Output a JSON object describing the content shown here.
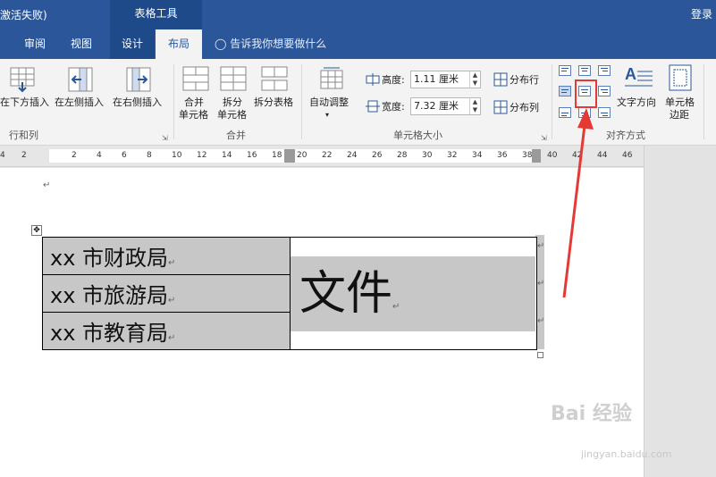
{
  "titlebar": {
    "title": "激活失败)",
    "contextual_tool": "表格工具",
    "login": "登录"
  },
  "tabs": [
    {
      "label": "审阅"
    },
    {
      "label": "视图"
    },
    {
      "label": "设计"
    },
    {
      "label": "布局"
    }
  ],
  "tell_me": "告诉我你想要做什么",
  "ribbon": {
    "rows_cols": {
      "insert_below": "在下方插入",
      "insert_left": "在左侧插入",
      "insert_right": "在右侧插入",
      "group_label": "行和列"
    },
    "merge": {
      "merge_cells_1": "合并",
      "merge_cells_2": "单元格",
      "split_cells_1": "拆分",
      "split_cells_2": "单元格",
      "split_table": "拆分表格",
      "group_label": "合并"
    },
    "cell_size": {
      "autofit": "自动调整",
      "height_label": "高度:",
      "height_value": "1.11 厘米",
      "width_label": "宽度:",
      "width_value": "7.32 厘米",
      "distribute_rows": "分布行",
      "distribute_cols": "分布列",
      "group_label": "单元格大小"
    },
    "alignment": {
      "text_direction": "文字方向",
      "cell_margins_1": "单元格",
      "cell_margins_2": "边距",
      "group_label": "对齐方式"
    }
  },
  "ruler": {
    "ticks": [
      "4",
      "2",
      "2",
      "4",
      "6",
      "8",
      "10",
      "12",
      "14",
      "16",
      "18",
      "20",
      "22",
      "24",
      "26",
      "28",
      "30",
      "32",
      "34",
      "36",
      "38",
      "40",
      "42",
      "44",
      "46"
    ]
  },
  "table": {
    "rows": [
      "xx 市财政局",
      "xx 市旅游局",
      "xx 市教育局"
    ],
    "merged_cell": "文件"
  },
  "watermark": {
    "main": "Bai 经验",
    "sub": "jingyan.baidu.com"
  },
  "colors": {
    "ribbon_blue": "#2b579a",
    "highlight": "#e53935"
  }
}
